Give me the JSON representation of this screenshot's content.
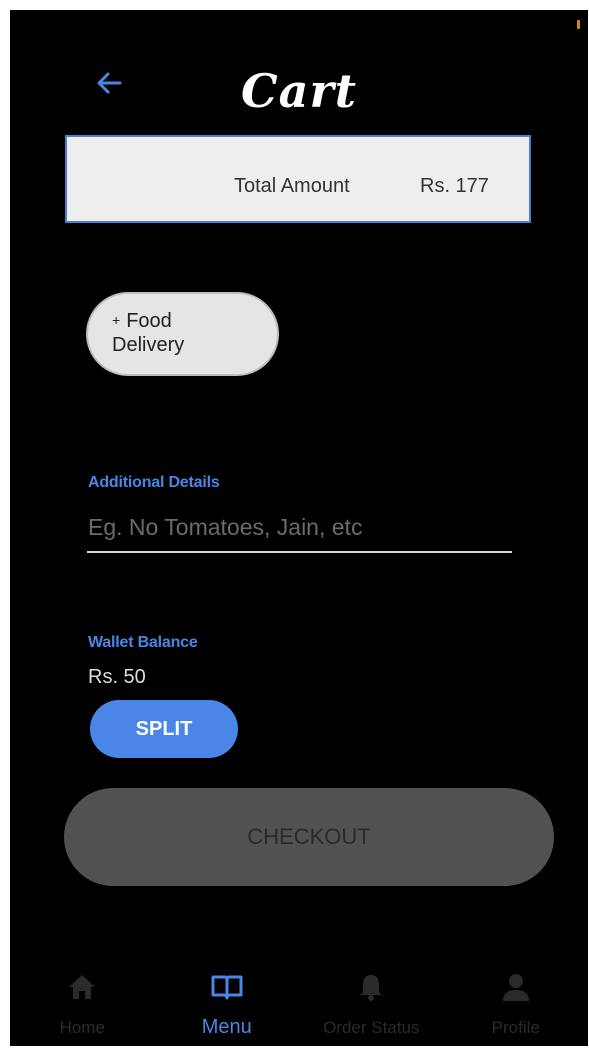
{
  "header": {
    "title": "Cart",
    "back_icon": "arrow-left-icon"
  },
  "total": {
    "label": "Total Amount",
    "value": "Rs. 177"
  },
  "delivery_option": {
    "plus": "+",
    "line1": "Food",
    "line2": "Delivery"
  },
  "details": {
    "label": "Additional Details",
    "placeholder": "Eg. No Tomatoes, Jain, etc",
    "value": ""
  },
  "wallet": {
    "label": "Wallet Balance",
    "value": "Rs. 50",
    "split_label": "SPLIT"
  },
  "checkout": {
    "label": "CHECKOUT"
  },
  "nav": {
    "items": [
      {
        "label": "Home",
        "icon": "home-icon"
      },
      {
        "label": "Menu",
        "icon": "book-icon"
      },
      {
        "label": "Order Status",
        "icon": "bell-icon"
      },
      {
        "label": "Profile",
        "icon": "person-icon"
      }
    ],
    "active_index": 1
  },
  "colors": {
    "background": "#000000",
    "accent": "#4a86e8",
    "card": "#eeeeee",
    "checkout_disabled": "#515151",
    "nav_inactive": "#2b2b2b"
  }
}
